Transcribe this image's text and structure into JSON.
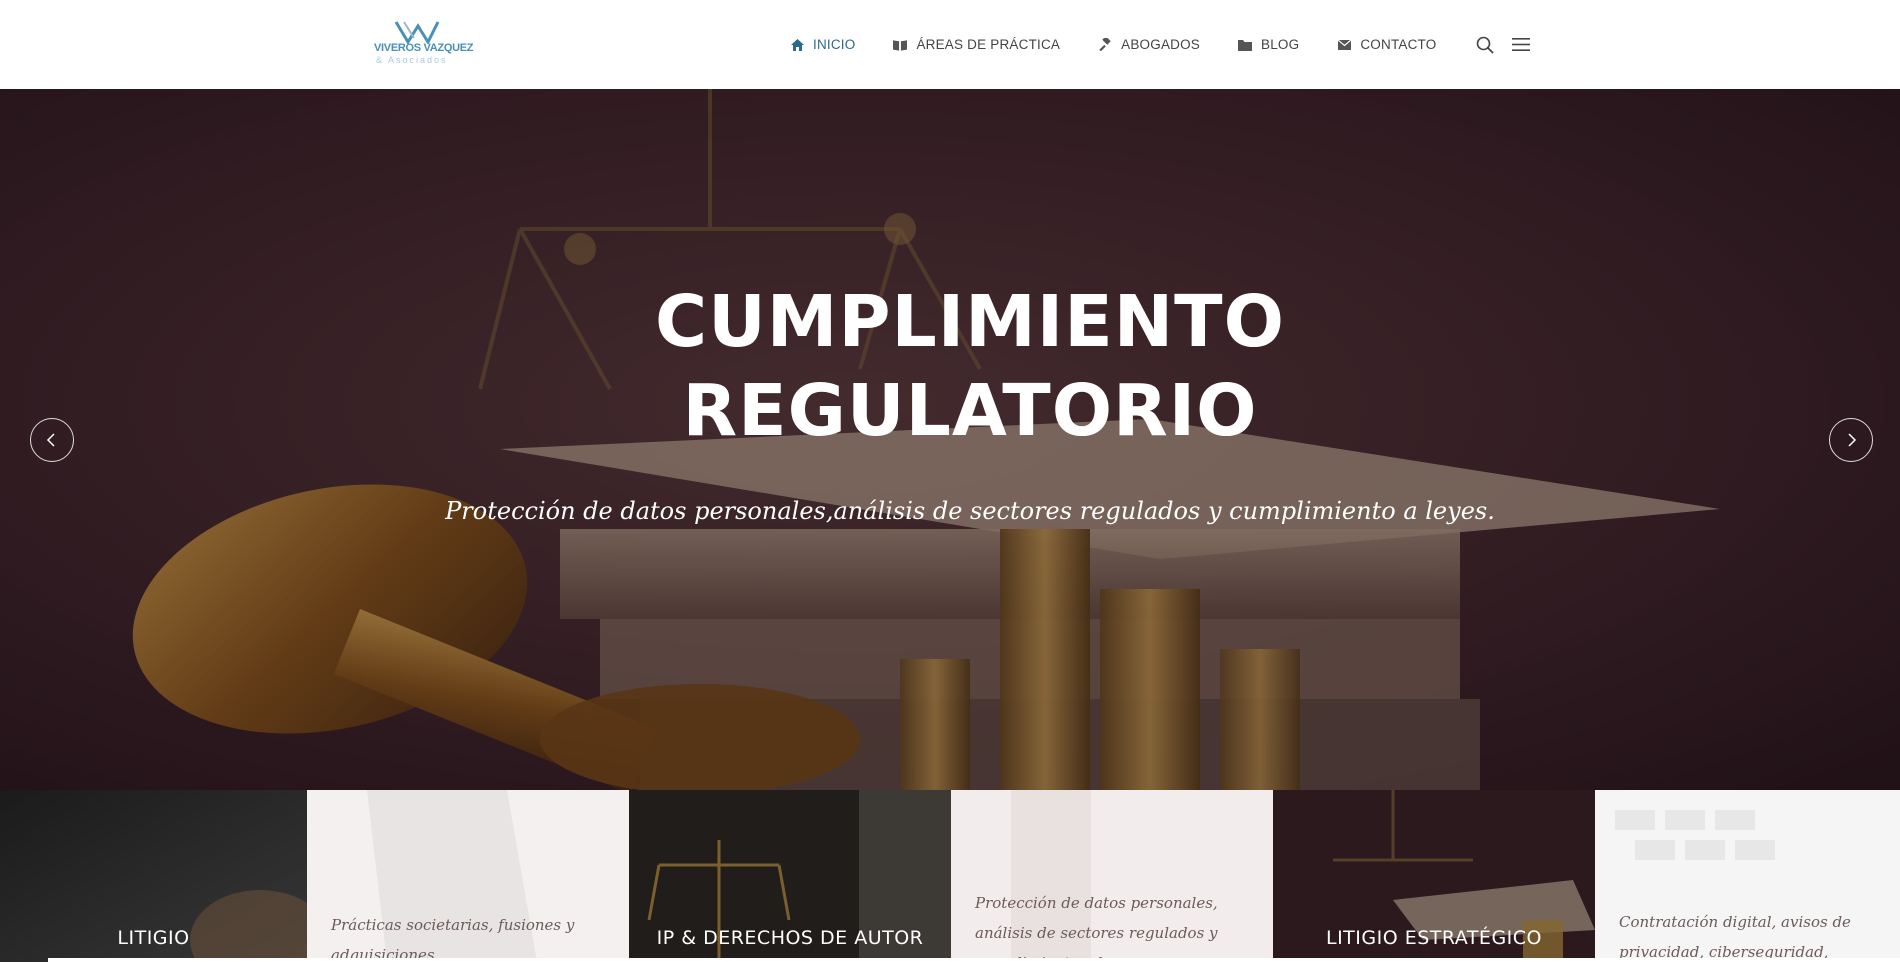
{
  "brand": {
    "logo_text": "VIVEROS VAZQUEZ",
    "logo_sub": "& Asociados",
    "colors": {
      "primary": "#2b6a8c",
      "logo_blue": "#4a8fb8"
    }
  },
  "nav": {
    "items": [
      {
        "label": "INICIO",
        "icon": "home-icon",
        "active": true
      },
      {
        "label": "ÁREAS DE PRÁCTICA",
        "icon": "book-icon",
        "active": false
      },
      {
        "label": "ABOGADOS",
        "icon": "gavel-icon",
        "active": false
      },
      {
        "label": "BLOG",
        "icon": "folder-icon",
        "active": false
      },
      {
        "label": "CONTACTO",
        "icon": "envelope-icon",
        "active": false
      }
    ],
    "search_icon": "search-icon",
    "menu_icon": "hamburger-menu-icon"
  },
  "hero": {
    "title_line1": "CUMPLIMIENTO",
    "title_line2": "REGULATORIO",
    "subtitle": "Protección de datos personales,análisis de sectores regulados y cumplimiento a leyes.",
    "prev_icon": "chevron-left-icon",
    "next_icon": "chevron-right-icon"
  },
  "tiles": [
    {
      "title": "LITIGIO",
      "desc": ""
    },
    {
      "title": "",
      "desc": "Prácticas societarias, fusiones y adquisiciones"
    },
    {
      "title": "IP & DERECHOS DE AUTOR",
      "desc": ""
    },
    {
      "title": "",
      "desc": "Protección de datos personales, análisis de sectores regulados y cumplimiento a leyes."
    },
    {
      "title": "LITIGIO ESTRATÉGICO",
      "desc": ""
    },
    {
      "title": "",
      "desc": "Contratación digital, avisos de privacidad, ciberseguridad, tecnologías"
    }
  ]
}
